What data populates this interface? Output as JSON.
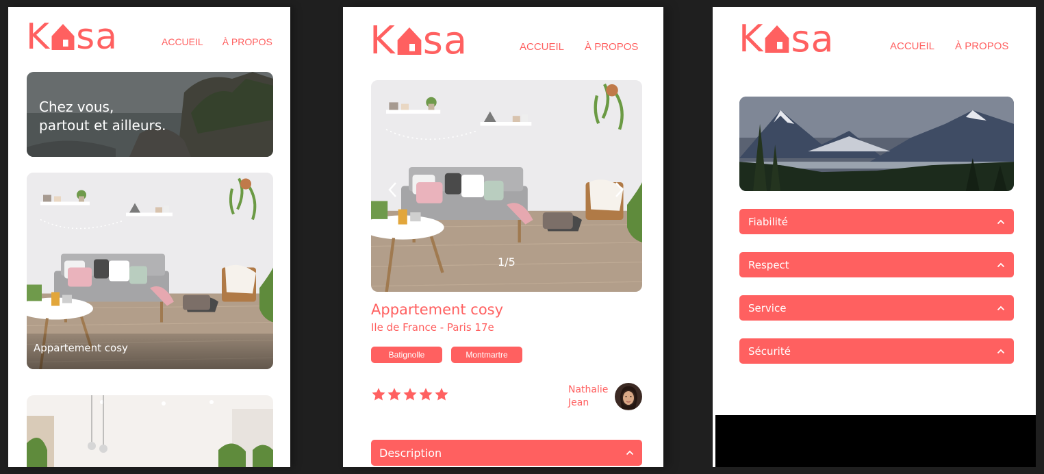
{
  "brand": {
    "logo_left": "K",
    "logo_right": "sa",
    "accent_color": "#ff6060"
  },
  "nav": {
    "home": "ACCUEIL",
    "about": "À PROPOS"
  },
  "home_screen": {
    "banner_text_line1": "Chez vous,",
    "banner_text_line2": "partout et ailleurs.",
    "cards": [
      {
        "title": "Appartement cosy"
      }
    ]
  },
  "listing_screen": {
    "carousel_counter": "1/5",
    "title": "Appartement cosy",
    "location": "Ile de France - Paris 17e",
    "tags": [
      "Batignolle",
      "Montmartre"
    ],
    "rating": 5,
    "rating_max": 5,
    "host_first_name": "Nathalie",
    "host_last_name": "Jean",
    "collapses": [
      {
        "label": "Description"
      }
    ]
  },
  "about_screen": {
    "collapses": [
      {
        "label": "Fiabilité"
      },
      {
        "label": "Respect"
      },
      {
        "label": "Service"
      },
      {
        "label": "Sécurité"
      }
    ]
  }
}
